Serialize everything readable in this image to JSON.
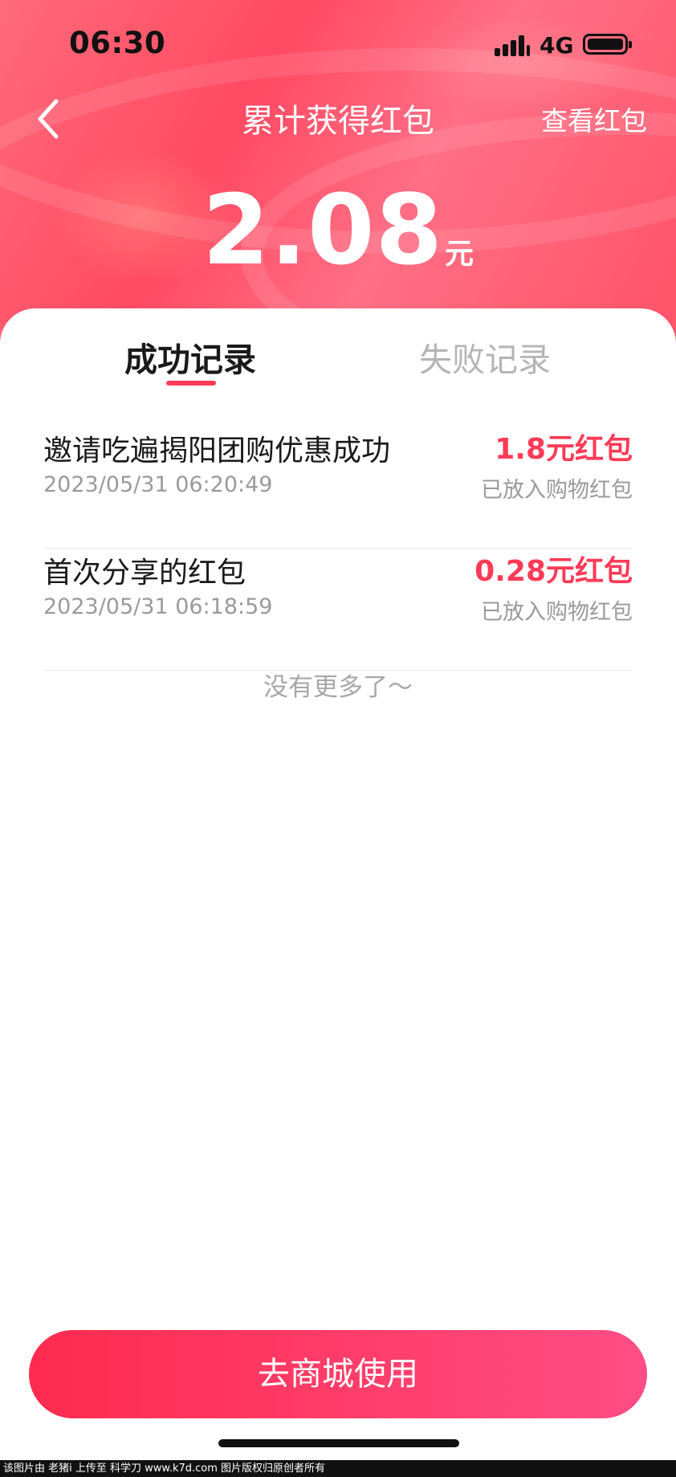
{
  "status_bar": {
    "time": "06:30",
    "network": "4G"
  },
  "nav": {
    "title": "累计获得红包",
    "action": "查看红包"
  },
  "summary": {
    "total": "2.08",
    "unit": "元"
  },
  "tabs": [
    {
      "label": "成功记录",
      "active": true
    },
    {
      "label": "失败记录",
      "active": false
    }
  ],
  "records": [
    {
      "title": "邀请吃遍揭阳团购优惠成功",
      "time": "2023/05/31 06:20:49",
      "amount": "1.8元红包",
      "note": "已放入购物红包"
    },
    {
      "title": "首次分享的红包",
      "time": "2023/05/31 06:18:59",
      "amount": "0.28元红包",
      "note": "已放入购物红包"
    }
  ],
  "list_end": "没有更多了～",
  "cta": "去商城使用",
  "watermark": "该图片由 老猪i 上传至 科学刀 www.k7d.com 图片版权归原创者所有",
  "colors": {
    "accent": "#ff3b57",
    "header": "#ff4a63"
  }
}
